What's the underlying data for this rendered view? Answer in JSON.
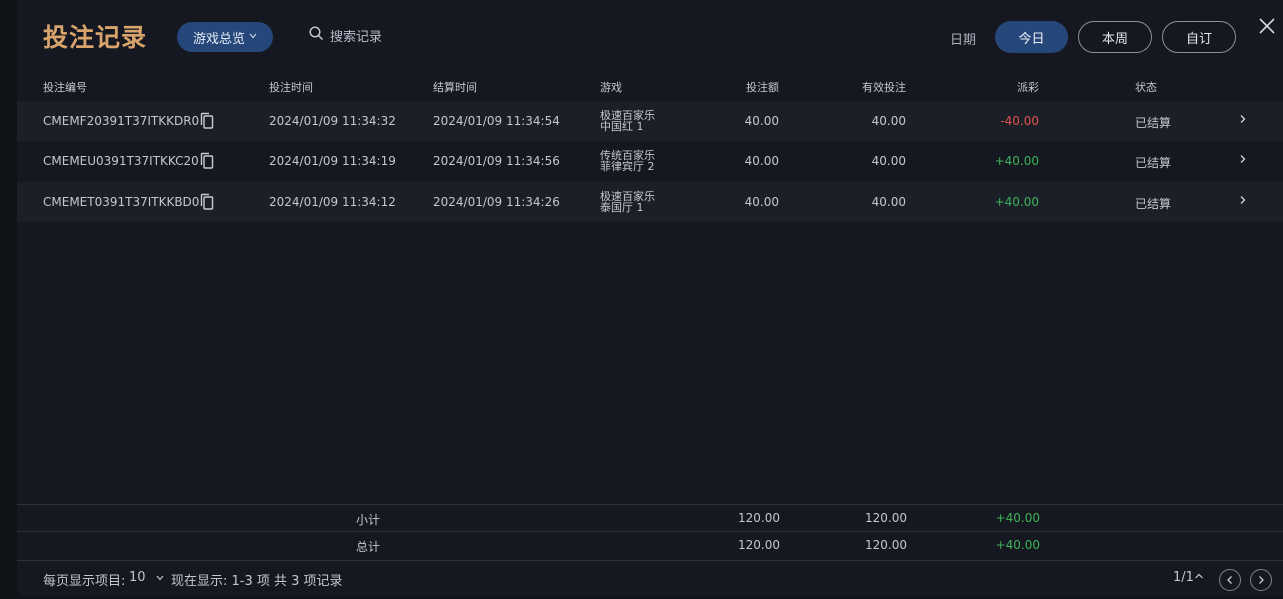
{
  "header": {
    "title": "投注记录",
    "game_filter": "游戏总览",
    "search_label": "搜索记录",
    "date_label": "日期",
    "date_tabs": [
      "今日",
      "本周",
      "自订"
    ]
  },
  "table": {
    "columns": [
      "投注编号",
      "投注时间",
      "结算时间",
      "游戏",
      "投注额",
      "有效投注",
      "派彩",
      "状态"
    ],
    "rows": [
      {
        "id": "CMEMF20391T37ITKKDR0",
        "bet_time": "2024/01/09 11:34:32",
        "settle_time": "2024/01/09 11:34:54",
        "game_line1": "极速百家乐",
        "game_line2": "中国红 1",
        "amount": "40.00",
        "valid": "40.00",
        "payout": "-40.00",
        "status": "已结算"
      },
      {
        "id": "CMEMEU0391T37ITKKC20",
        "bet_time": "2024/01/09 11:34:19",
        "settle_time": "2024/01/09 11:34:56",
        "game_line1": "传统百家乐",
        "game_line2": "菲律宾厅 2",
        "amount": "40.00",
        "valid": "40.00",
        "payout": "+40.00",
        "status": "已结算"
      },
      {
        "id": "CMEMET0391T37ITKKBD0",
        "bet_time": "2024/01/09 11:34:12",
        "settle_time": "2024/01/09 11:34:26",
        "game_line1": "极速百家乐",
        "game_line2": "泰国厅 1",
        "amount": "40.00",
        "valid": "40.00",
        "payout": "+40.00",
        "status": "已结算"
      }
    ]
  },
  "summary": {
    "subtotal": {
      "label": "小计",
      "amount": "120.00",
      "valid": "120.00",
      "payout": "+40.00"
    },
    "total": {
      "label": "总计",
      "amount": "120.00",
      "valid": "120.00",
      "payout": "+40.00"
    }
  },
  "footer": {
    "per_page_label": "每页显示项目:",
    "per_page_value": "10",
    "showing_text": "现在显示: 1-3 项 共 3 项记录",
    "page_indicator": "1/1"
  },
  "colors": {
    "accent": "#25477a",
    "title": "#d9a46b",
    "negative": "#e0514c",
    "positive": "#3fb25a"
  }
}
